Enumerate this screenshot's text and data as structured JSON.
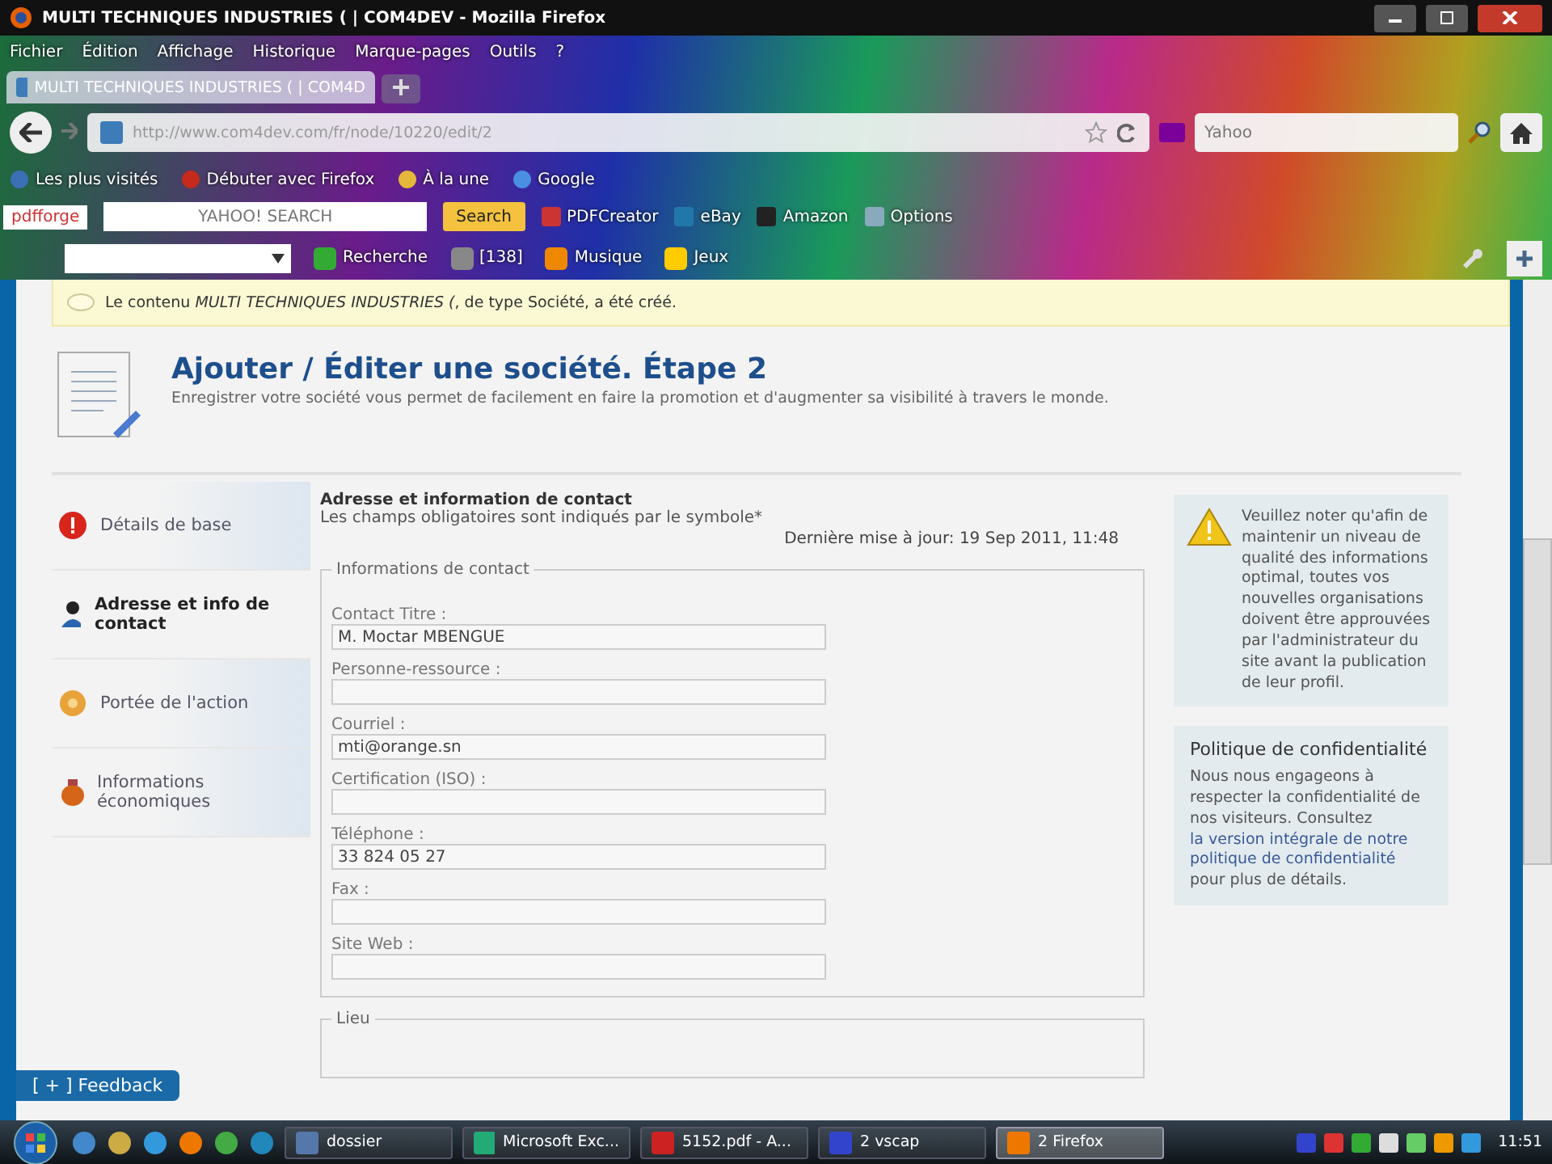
{
  "window": {
    "title": "MULTI TECHNIQUES INDUSTRIES ( | COM4DEV - Mozilla Firefox"
  },
  "menu": [
    "Fichier",
    "Édition",
    "Affichage",
    "Historique",
    "Marque-pages",
    "Outils",
    "?"
  ],
  "tabs": [
    {
      "label": "MULTI TECHNIQUES INDUSTRIES ( | COM4D",
      "selected": true
    }
  ],
  "address_bar": {
    "url": "http://www.com4dev.com/fr/node/10220/edit/2"
  },
  "search_bar": {
    "placeholder": "Yahoo"
  },
  "bookmarks": [
    "Les plus visités",
    "Débuter avec Firefox",
    "À la une",
    "Google"
  ],
  "toolbar_1": {
    "brand": "pdfforge",
    "search_placeholder": "YAHOO! SEARCH",
    "search_button": "Search",
    "items": [
      "PDFCreator",
      "eBay",
      "Amazon",
      "Options"
    ]
  },
  "toolbar_2": {
    "items": [
      "Recherche",
      "[138]",
      "Musique",
      "Jeux"
    ]
  },
  "status_message": {
    "text": "Le contenu *MULTI TECHNIQUES INDUSTRIES (*, de type Société, a été créé."
  },
  "page_header": {
    "title": "Ajouter / Éditer une société. Étape 2",
    "subtitle": "Enregistrer votre société vous permet de facilement en faire la promotion et d'augmenter sa visibilité à travers le monde."
  },
  "steps": [
    {
      "label": "Détails de base",
      "kind": "info",
      "selected": false
    },
    {
      "label": "Adresse et info de contact",
      "kind": "person",
      "selected": true
    },
    {
      "label": "Portée de l'action",
      "kind": "gear",
      "selected": false
    },
    {
      "label": "Informations économiques",
      "kind": "bag",
      "selected": false
    }
  ],
  "form": {
    "heading": "Adresse et information de contact",
    "note": "Les champs obligatoires sont indiqués par le symbole*",
    "updated": "Dernière mise à jour: 19 Sep 2011, 11:48",
    "fieldsets": [
      {
        "legend": "Informations de contact",
        "fields": [
          {
            "label": "Contact Titre :",
            "value": "M. Moctar MBENGUE"
          },
          {
            "label": "Personne-ressource :"
          },
          {
            "label": "Courriel :",
            "value": "mti@orange.sn"
          },
          {
            "label": "Certification (ISO) :"
          },
          {
            "label": "Téléphone :",
            "value": "33 824 05 27"
          },
          {
            "label": "Fax :"
          },
          {
            "label": "Site Web :"
          }
        ]
      },
      {
        "legend": "Lieu"
      }
    ]
  },
  "notice": {
    "text": "Veuillez noter qu'afin de maintenir un niveau de qualité des informations optimal, toutes vos nouvelles organisations doivent être approuvées par l'administrateur du site avant la publication de leur profil."
  },
  "privacy": {
    "title": "Politique de confidentialité",
    "text": "Nous nous engageons à respecter la confidentialité de nos visiteurs. Consultez",
    "link": "la version intégrale de notre politique de confidentialité",
    "after": "pour plus de détails."
  },
  "feedback": {
    "label": "[ + ] Feedback"
  },
  "taskbar": {
    "tasks": [
      {
        "label": "dossier",
        "selected": false
      },
      {
        "label": "Microsoft Exc...",
        "selected": false
      },
      {
        "label": "5152.pdf - A...",
        "selected": false
      },
      {
        "label": "2 vscap",
        "selected": false
      },
      {
        "label": "2 Firefox",
        "selected": true
      }
    ],
    "clock": "11:51"
  }
}
